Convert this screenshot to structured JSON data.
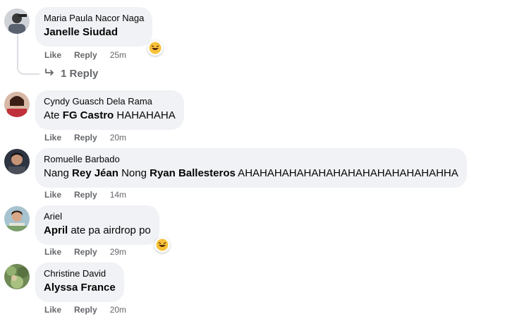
{
  "colors": {
    "bubble": "#f0f2f5",
    "meta": "#65676b",
    "text": "#050505"
  },
  "comments": [
    {
      "author": "Maria Paula Nacor Naga",
      "tag": "Janelle Siudad",
      "text": "",
      "like": "Like",
      "reply": "Reply",
      "time": "25m",
      "reaction": "haha-emoji-icon",
      "replies": "1 Reply"
    },
    {
      "author": "Cyndy Guasch Dela Rama",
      "prefix": "Ate ",
      "tag": "FG Castro",
      "text": " HAHAHAHA",
      "like": "Like",
      "reply": "Reply",
      "time": "20m"
    },
    {
      "author": "Romuelle Barbado",
      "prefix": "Nang ",
      "tag": "Rey Jéan",
      "mid": " Nong ",
      "tag2": "Ryan Ballesteros",
      "text": " AHAHAHAHAHAHAHAHAHAHAHAHAHAHHA",
      "like": "Like",
      "reply": "Reply",
      "time": "14m"
    },
    {
      "author": "Ariel",
      "tag": "April",
      "text": " ate pa airdrop po",
      "like": "Like",
      "reply": "Reply",
      "time": "29m",
      "reaction": "haha-emoji-icon"
    },
    {
      "author": "Christine David",
      "tag": "Alyssa France",
      "text": "",
      "like": "Like",
      "reply": "Reply",
      "time": "20m"
    }
  ]
}
